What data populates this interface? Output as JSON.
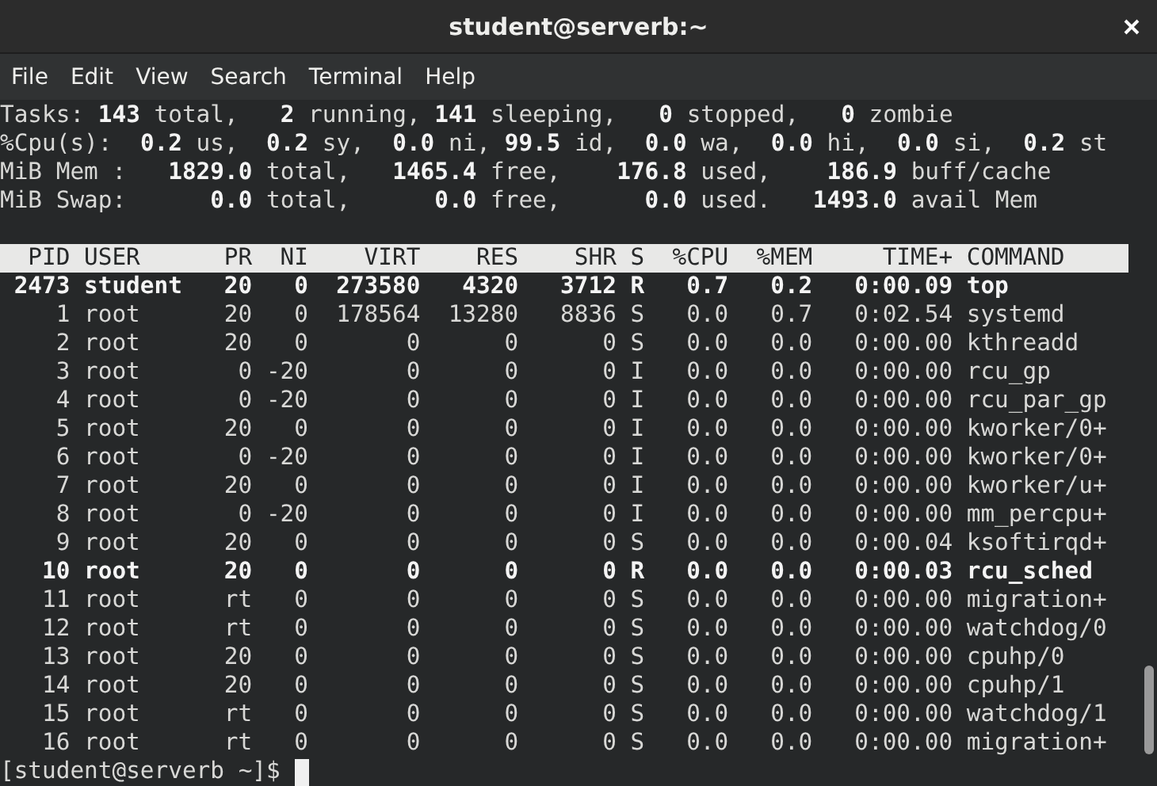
{
  "window": {
    "title": "student@serverb:~"
  },
  "menu": [
    "File",
    "Edit",
    "View",
    "Search",
    "Terminal",
    "Help"
  ],
  "summary": [
    "Tasks: **143** total,   **2** running, **141** sleeping,   **0** stopped,   **0** zombie",
    "%Cpu(s):  **0.2** us,  **0.2** sy,  **0.0** ni, **99.5** id,  **0.0** wa,  **0.0** hi,  **0.0** si,  **0.2** st",
    "MiB Mem :   **1829.0** total,   **1465.4** free,    **176.8** used,    **186.9** buff/cache",
    "MiB Swap:      **0.0** total,      **0.0** free,      **0.0** used.   **1493.0** avail Mem"
  ],
  "table": {
    "columns": [
      "PID",
      "USER",
      "PR",
      "NI",
      "VIRT",
      "RES",
      "SHR",
      "S",
      "%CPU",
      "%MEM",
      "TIME+",
      "COMMAND"
    ],
    "rows": [
      {
        "bold": true,
        "cells": [
          "2473",
          "student",
          "20",
          "0",
          "273580",
          "4320",
          "3712",
          "R",
          "0.7",
          "0.2",
          "0:00.09",
          "top"
        ]
      },
      {
        "bold": false,
        "cells": [
          "1",
          "root",
          "20",
          "0",
          "178564",
          "13280",
          "8836",
          "S",
          "0.0",
          "0.7",
          "0:02.54",
          "systemd"
        ]
      },
      {
        "bold": false,
        "cells": [
          "2",
          "root",
          "20",
          "0",
          "0",
          "0",
          "0",
          "S",
          "0.0",
          "0.0",
          "0:00.00",
          "kthreadd"
        ]
      },
      {
        "bold": false,
        "cells": [
          "3",
          "root",
          "0",
          "-20",
          "0",
          "0",
          "0",
          "I",
          "0.0",
          "0.0",
          "0:00.00",
          "rcu_gp"
        ]
      },
      {
        "bold": false,
        "cells": [
          "4",
          "root",
          "0",
          "-20",
          "0",
          "0",
          "0",
          "I",
          "0.0",
          "0.0",
          "0:00.00",
          "rcu_par_gp"
        ]
      },
      {
        "bold": false,
        "cells": [
          "5",
          "root",
          "20",
          "0",
          "0",
          "0",
          "0",
          "I",
          "0.0",
          "0.0",
          "0:00.00",
          "kworker/0+"
        ]
      },
      {
        "bold": false,
        "cells": [
          "6",
          "root",
          "0",
          "-20",
          "0",
          "0",
          "0",
          "I",
          "0.0",
          "0.0",
          "0:00.00",
          "kworker/0+"
        ]
      },
      {
        "bold": false,
        "cells": [
          "7",
          "root",
          "20",
          "0",
          "0",
          "0",
          "0",
          "I",
          "0.0",
          "0.0",
          "0:00.00",
          "kworker/u+"
        ]
      },
      {
        "bold": false,
        "cells": [
          "8",
          "root",
          "0",
          "-20",
          "0",
          "0",
          "0",
          "I",
          "0.0",
          "0.0",
          "0:00.00",
          "mm_percpu+"
        ]
      },
      {
        "bold": false,
        "cells": [
          "9",
          "root",
          "20",
          "0",
          "0",
          "0",
          "0",
          "S",
          "0.0",
          "0.0",
          "0:00.04",
          "ksoftirqd+"
        ]
      },
      {
        "bold": true,
        "cells": [
          "10",
          "root",
          "20",
          "0",
          "0",
          "0",
          "0",
          "R",
          "0.0",
          "0.0",
          "0:00.03",
          "rcu_sched"
        ]
      },
      {
        "bold": false,
        "cells": [
          "11",
          "root",
          "rt",
          "0",
          "0",
          "0",
          "0",
          "S",
          "0.0",
          "0.0",
          "0:00.00",
          "migration+"
        ]
      },
      {
        "bold": false,
        "cells": [
          "12",
          "root",
          "rt",
          "0",
          "0",
          "0",
          "0",
          "S",
          "0.0",
          "0.0",
          "0:00.00",
          "watchdog/0"
        ]
      },
      {
        "bold": false,
        "cells": [
          "13",
          "root",
          "20",
          "0",
          "0",
          "0",
          "0",
          "S",
          "0.0",
          "0.0",
          "0:00.00",
          "cpuhp/0"
        ]
      },
      {
        "bold": false,
        "cells": [
          "14",
          "root",
          "20",
          "0",
          "0",
          "0",
          "0",
          "S",
          "0.0",
          "0.0",
          "0:00.00",
          "cpuhp/1"
        ]
      },
      {
        "bold": false,
        "cells": [
          "15",
          "root",
          "rt",
          "0",
          "0",
          "0",
          "0",
          "S",
          "0.0",
          "0.0",
          "0:00.00",
          "watchdog/1"
        ]
      },
      {
        "bold": false,
        "cells": [
          "16",
          "root",
          "rt",
          "0",
          "0",
          "0",
          "0",
          "S",
          "0.0",
          "0.0",
          "0:00.00",
          "migration+"
        ]
      }
    ]
  },
  "prompt": "[student@serverb ~]$"
}
